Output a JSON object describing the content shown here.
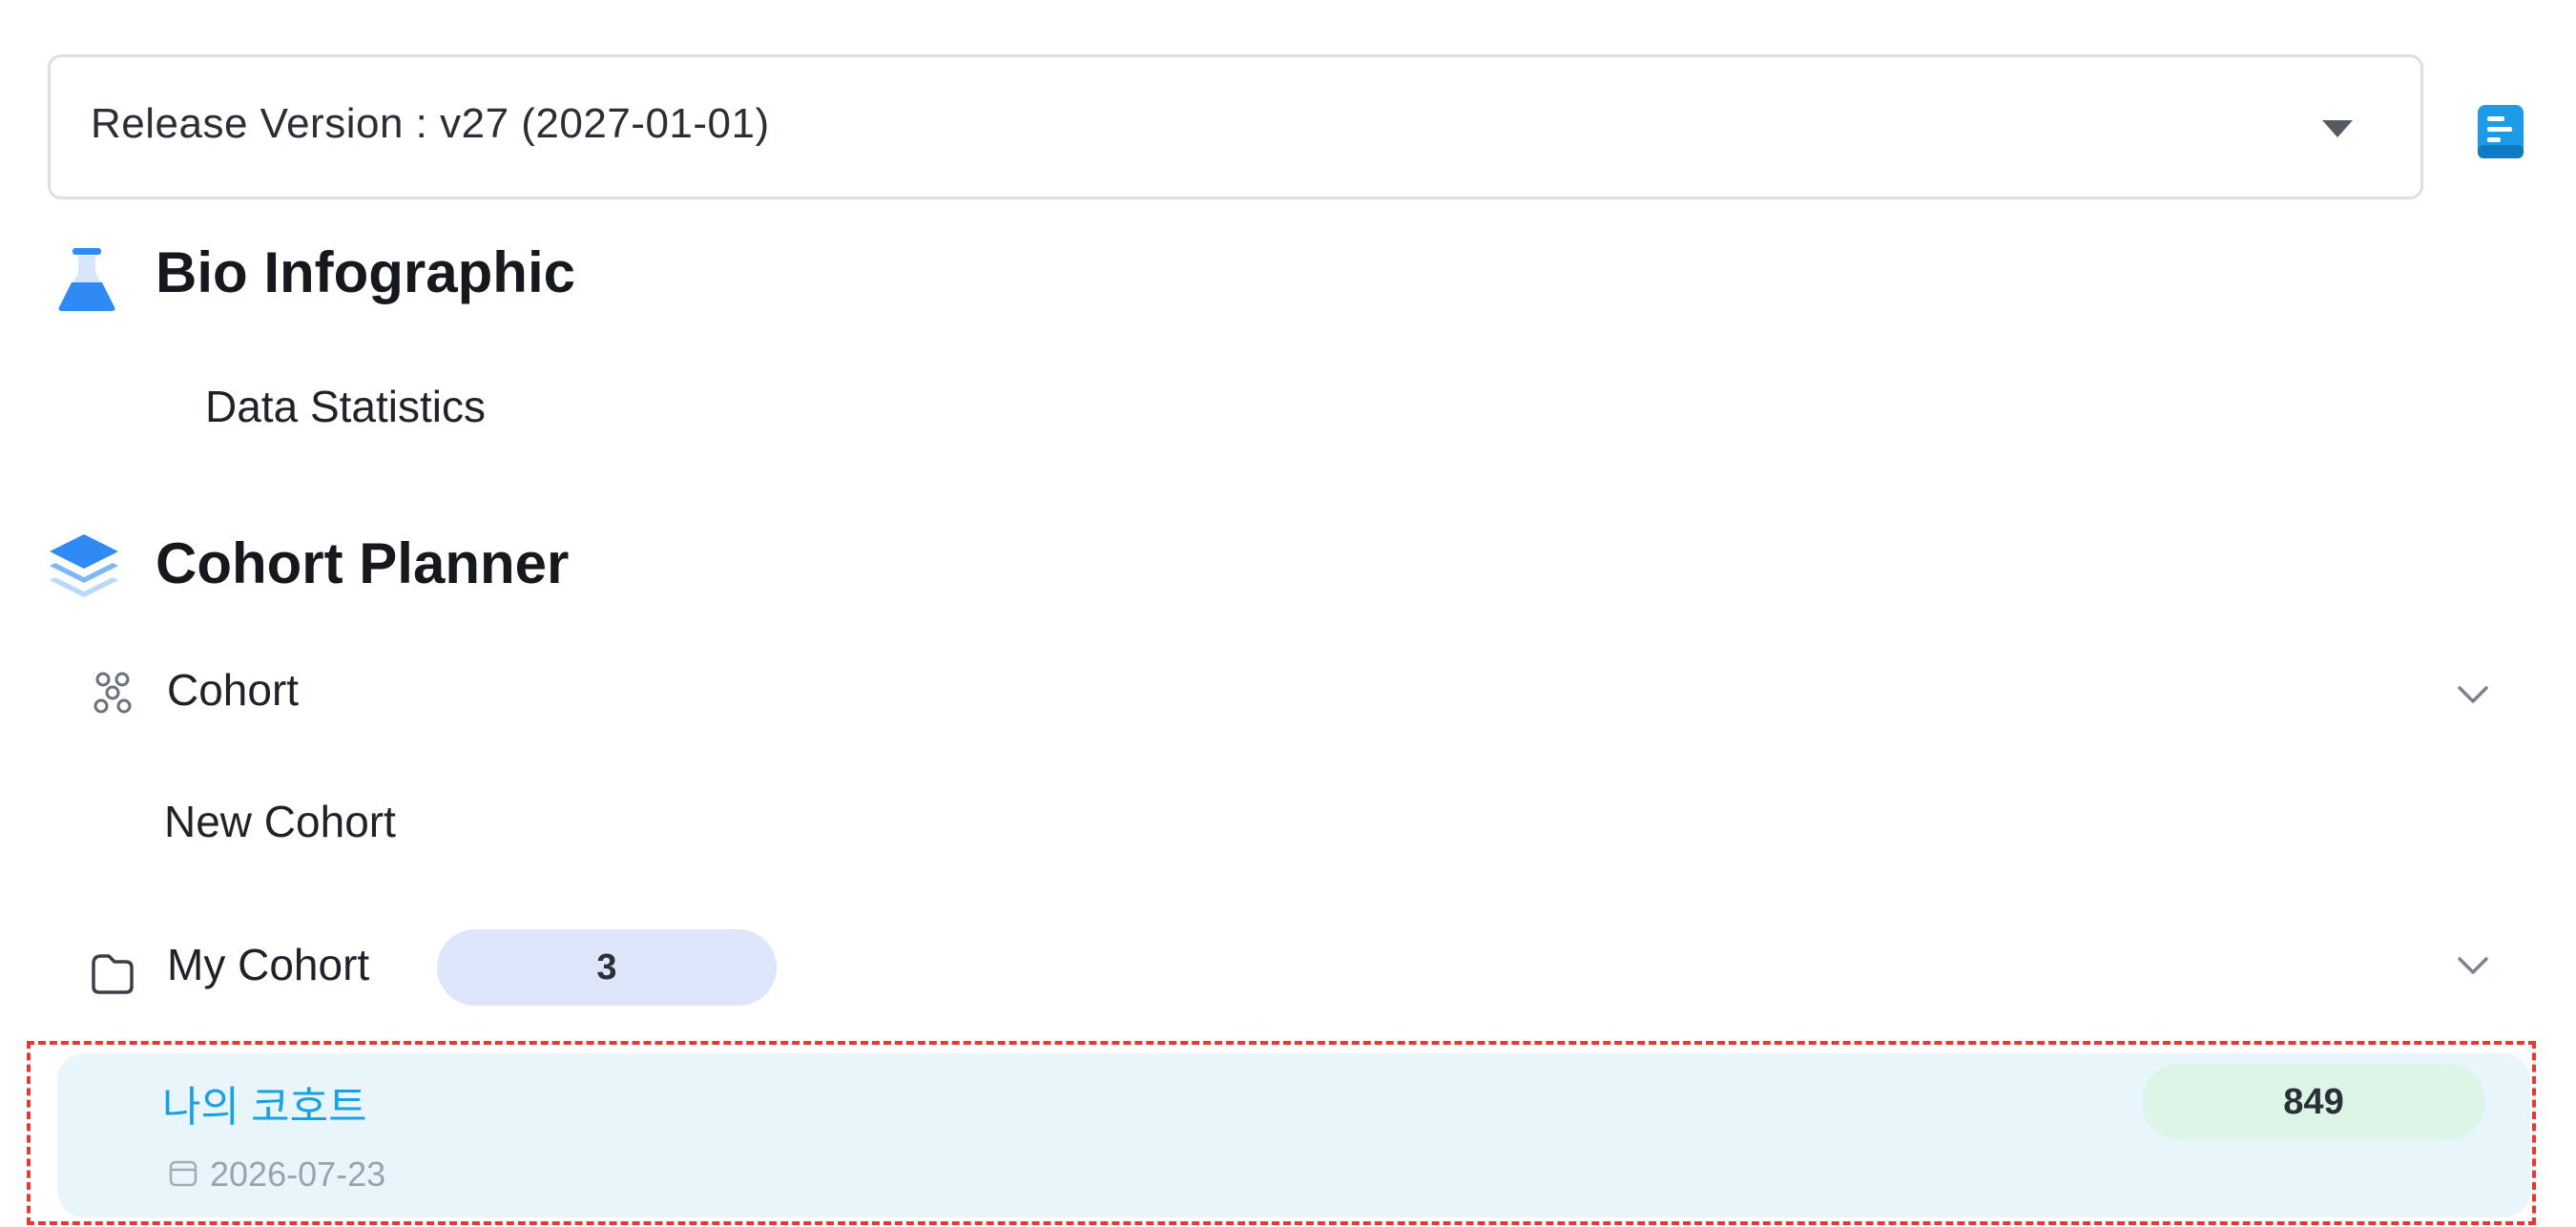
{
  "release": {
    "label": "Release Version : v27 (2027-01-01)"
  },
  "bio": {
    "title": "Bio Infographic",
    "items": [
      {
        "label": "Data Statistics"
      }
    ]
  },
  "planner": {
    "title": "Cohort Planner",
    "cohort_group": {
      "label": "Cohort",
      "items": [
        {
          "label": "New Cohort"
        }
      ]
    },
    "my_cohort": {
      "label": "My Cohort",
      "count": "3",
      "items": [
        {
          "name": "나의 코호트",
          "date": "2026-07-23",
          "count": "849"
        }
      ]
    }
  },
  "icons": {
    "release_doc": "document-icon",
    "bio": "flask-icon",
    "planner": "layers-icon",
    "cohort": "people-icon",
    "my_cohort": "folder-icon",
    "date": "calendar-icon",
    "expand": "chevron-down-icon"
  },
  "colors": {
    "accent": "#2a8cf5",
    "cohort_link": "#1aa1e3",
    "selected_bg": "#e8f5fb",
    "count_badge_bg": "#dde6fb",
    "total_badge_bg": "#dcf5e7",
    "highlight_border": "#e53935"
  }
}
